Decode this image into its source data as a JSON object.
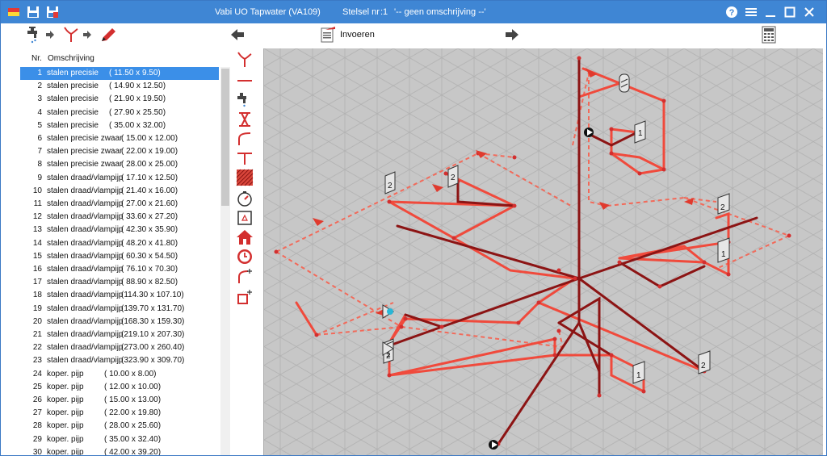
{
  "titlebar": {
    "app_title": "Vabi UO Tapwater (VA109)",
    "stelsel_label": "Stelsel nr",
    "stelsel_number": ":1",
    "stelsel_description": "'-- geen omschrijving --'",
    "buttons": [
      "help-icon",
      "menu-icon",
      "minimize-icon",
      "maximize-icon",
      "close-icon"
    ]
  },
  "toolbar": {
    "invoeren_label": "Invoeren"
  },
  "list": {
    "header_nr": "Nr.",
    "header_omschrijving": "Omschrijving",
    "selected_index": 0,
    "rows": [
      {
        "nr": "1",
        "desc": "stalen precisie",
        "dims": "( 11.50 x   9.50)"
      },
      {
        "nr": "2",
        "desc": "stalen precisie",
        "dims": "( 14.90 x  12.50)"
      },
      {
        "nr": "3",
        "desc": "stalen precisie",
        "dims": "( 21.90 x  19.50)"
      },
      {
        "nr": "4",
        "desc": "stalen precisie",
        "dims": "( 27.90 x  25.50)"
      },
      {
        "nr": "5",
        "desc": "stalen precisie",
        "dims": "( 35.00 x  32.00)"
      },
      {
        "nr": "6",
        "desc": "stalen precisie zwaar",
        "dims": "( 15.00 x  12.00)"
      },
      {
        "nr": "7",
        "desc": "stalen precisie zwaar",
        "dims": "( 22.00 x  19.00)"
      },
      {
        "nr": "8",
        "desc": "stalen precisie zwaar",
        "dims": "( 28.00 x  25.00)"
      },
      {
        "nr": "9",
        "desc": "stalen draad/vlampijp",
        "dims": "( 17.10 x  12.50)"
      },
      {
        "nr": "10",
        "desc": "stalen draad/vlampijp",
        "dims": "( 21.40 x  16.00)"
      },
      {
        "nr": "11",
        "desc": "stalen draad/vlampijp",
        "dims": "( 27.00 x  21.60)"
      },
      {
        "nr": "12",
        "desc": "stalen draad/vlampijp",
        "dims": "( 33.60 x  27.20)"
      },
      {
        "nr": "13",
        "desc": "stalen draad/vlampijp",
        "dims": "( 42.30 x  35.90)"
      },
      {
        "nr": "14",
        "desc": "stalen draad/vlampijp",
        "dims": "( 48.20 x  41.80)"
      },
      {
        "nr": "15",
        "desc": "stalen draad/vlampijp",
        "dims": "( 60.30 x  54.50)"
      },
      {
        "nr": "16",
        "desc": "stalen draad/vlampijp",
        "dims": "( 76.10 x  70.30)"
      },
      {
        "nr": "17",
        "desc": "stalen draad/vlampijp",
        "dims": "( 88.90 x  82.50)"
      },
      {
        "nr": "18",
        "desc": "stalen draad/vlampijp",
        "dims": "(114.30 x 107.10)"
      },
      {
        "nr": "19",
        "desc": "stalen draad/vlampijp",
        "dims": "(139.70 x 131.70)"
      },
      {
        "nr": "20",
        "desc": "stalen draad/vlampijp",
        "dims": "(168.30 x 159.30)"
      },
      {
        "nr": "21",
        "desc": "stalen draad/vlampijp",
        "dims": "(219.10 x 207.30)"
      },
      {
        "nr": "22",
        "desc": "stalen draad/vlampijp",
        "dims": "(273.00 x 260.40)"
      },
      {
        "nr": "23",
        "desc": "stalen draad/vlampijp",
        "dims": "(323.90 x 309.70)"
      },
      {
        "nr": "24",
        "desc": "koper. pijp",
        "dims": "( 10.00 x   8.00)"
      },
      {
        "nr": "25",
        "desc": "koper. pijp",
        "dims": "( 12.00 x  10.00)"
      },
      {
        "nr": "26",
        "desc": "koper. pijp",
        "dims": "( 15.00 x  13.00)"
      },
      {
        "nr": "27",
        "desc": "koper. pijp",
        "dims": "( 22.00 x  19.80)"
      },
      {
        "nr": "28",
        "desc": "koper. pijp",
        "dims": "( 28.00 x  25.60)"
      },
      {
        "nr": "29",
        "desc": "koper. pijp",
        "dims": "( 35.00 x  32.40)"
      },
      {
        "nr": "30",
        "desc": "koper. pijp",
        "dims": "( 42.00 x  39.20)"
      }
    ]
  },
  "drawing": {
    "tap_labels": [
      "1",
      "1",
      "1",
      "2",
      "2",
      "2",
      "2",
      "2",
      "1"
    ],
    "colors": {
      "background": "#c7c7c7",
      "grid": "#b3b3b3",
      "pipe_light": "#f04a3c",
      "pipe_dark": "#8c1414",
      "pipe_dashed": "#f26a5a",
      "accent": "#3f86d4"
    }
  }
}
